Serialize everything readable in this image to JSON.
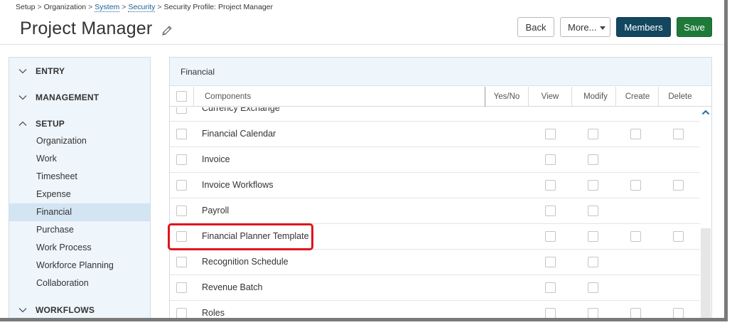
{
  "breadcrumb": [
    {
      "label": "Setup",
      "link": false
    },
    {
      "label": "Organization",
      "link": false
    },
    {
      "label": "System",
      "link": true
    },
    {
      "label": "Security",
      "link": true
    },
    {
      "label": "Security Profile: Project Manager",
      "link": false
    }
  ],
  "header": {
    "title": "Project Manager",
    "buttons": {
      "back": "Back",
      "more": "More...",
      "members": "Members",
      "save": "Save"
    }
  },
  "sidebar": {
    "sections": [
      {
        "label": "ENTRY",
        "expanded": false
      },
      {
        "label": "MANAGEMENT",
        "expanded": false
      },
      {
        "label": "SETUP",
        "expanded": true
      },
      {
        "label": "WORKFLOWS",
        "expanded": false
      }
    ],
    "setup_items": [
      {
        "label": "Organization",
        "active": false
      },
      {
        "label": "Work",
        "active": false
      },
      {
        "label": "Timesheet",
        "active": false
      },
      {
        "label": "Expense",
        "active": false
      },
      {
        "label": "Financial",
        "active": true
      },
      {
        "label": "Purchase",
        "active": false
      },
      {
        "label": "Work Process",
        "active": false
      },
      {
        "label": "Workforce Planning",
        "active": false
      },
      {
        "label": "Collaboration",
        "active": false
      }
    ]
  },
  "panel": {
    "title": "Financial",
    "columns": [
      "Components",
      "Yes/No",
      "View",
      "Modify",
      "Create",
      "Delete"
    ],
    "rows": [
      {
        "name": "Currency Exchange",
        "checks": [
          true,
          false,
          false,
          false,
          false
        ]
      },
      {
        "name": "Financial Calendar",
        "checks": [
          false,
          true,
          true,
          true,
          true
        ]
      },
      {
        "name": "Invoice",
        "checks": [
          false,
          true,
          true,
          false,
          false
        ]
      },
      {
        "name": "Invoice Workflows",
        "checks": [
          false,
          true,
          true,
          true,
          true
        ]
      },
      {
        "name": "Payroll",
        "checks": [
          false,
          true,
          true,
          false,
          false
        ]
      },
      {
        "name": "Financial Planner Template",
        "checks": [
          false,
          true,
          true,
          true,
          true
        ]
      },
      {
        "name": "Recognition Schedule",
        "checks": [
          false,
          true,
          true,
          false,
          false
        ]
      },
      {
        "name": "Revenue Batch",
        "checks": [
          false,
          true,
          true,
          false,
          false
        ]
      },
      {
        "name": "Roles",
        "checks": [
          false,
          true,
          true,
          true,
          true
        ]
      }
    ],
    "highlighted_row": "Financial Planner Template"
  },
  "colors": {
    "members_button": "#12475f",
    "save_button": "#1f7a3a",
    "highlight": "#e0141b",
    "sidebar_bg": "#eef5fb",
    "active_item": "#d3e4f3",
    "link": "#1a5e96"
  }
}
